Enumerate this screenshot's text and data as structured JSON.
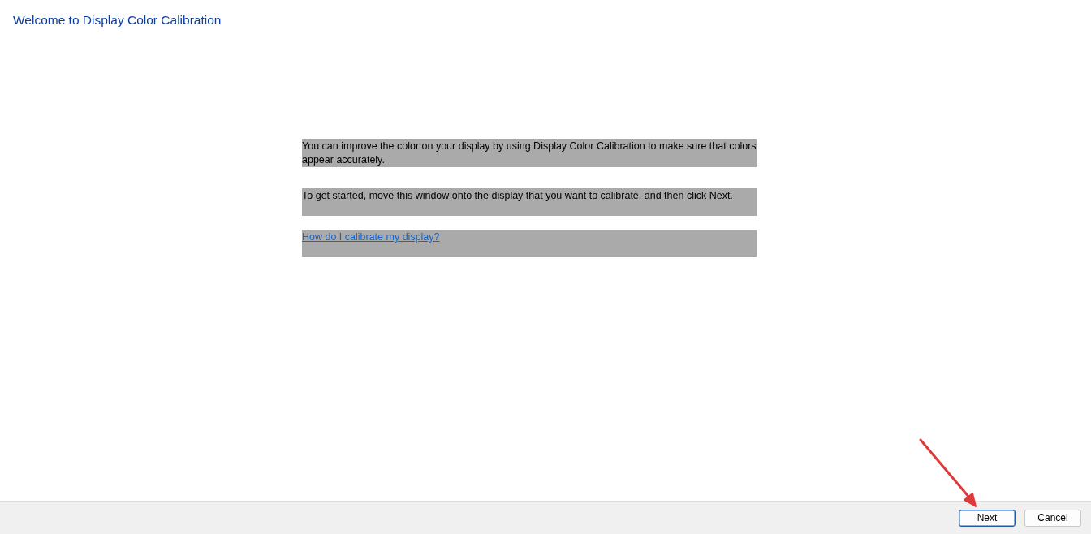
{
  "window": {
    "title": "Welcome to Display Color Calibration"
  },
  "paragraphs": [
    {
      "kind": "text",
      "text": "You can improve the color on your display by using Display Color Calibration to make sure that colors appear accurately."
    },
    {
      "kind": "text",
      "text": "To get started, move this window onto the display that you want to calibrate, and then click Next."
    },
    {
      "kind": "link",
      "text": "How do I calibrate my display?"
    }
  ],
  "buttons": [
    {
      "label": "Next",
      "default": true
    },
    {
      "label": "Cancel",
      "default": false
    }
  ]
}
